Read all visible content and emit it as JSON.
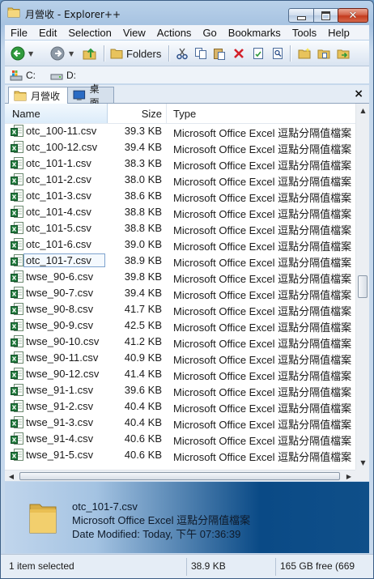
{
  "window": {
    "title": "月營收 - Explorer++",
    "minimize_icon": "minimize-icon",
    "maximize_icon": "maximize-icon",
    "close_icon": "close-icon"
  },
  "menu": {
    "items": [
      "File",
      "Edit",
      "Selection",
      "View",
      "Actions",
      "Go",
      "Bookmarks",
      "Tools",
      "Help"
    ]
  },
  "toolbar": {
    "folders_label": "Folders",
    "icons": [
      "back-icon",
      "forward-icon",
      "up-icon",
      "folders-icon",
      "cut-icon",
      "copy-icon",
      "paste-icon",
      "delete-icon",
      "properties-icon",
      "search-icon",
      "new-folder-icon",
      "copy-to-icon",
      "move-to-icon"
    ]
  },
  "drives": [
    {
      "label": "C:",
      "icon": "system-drive-icon"
    },
    {
      "label": "D:",
      "icon": "drive-icon"
    }
  ],
  "tabs": [
    {
      "label": "月營收",
      "active": true,
      "icon": "folder-icon"
    },
    {
      "label": "桌面",
      "active": false,
      "icon": "desktop-icon"
    }
  ],
  "tab_close_label": "×",
  "columns": {
    "name": "Name",
    "size": "Size",
    "type": "Type"
  },
  "files": [
    {
      "name": "otc_100-11.csv",
      "size": "39.3 KB",
      "type": "Microsoft Office Excel 逗點分隔值檔案"
    },
    {
      "name": "otc_100-12.csv",
      "size": "39.4 KB",
      "type": "Microsoft Office Excel 逗點分隔值檔案"
    },
    {
      "name": "otc_101-1.csv",
      "size": "38.3 KB",
      "type": "Microsoft Office Excel 逗點分隔值檔案"
    },
    {
      "name": "otc_101-2.csv",
      "size": "38.0 KB",
      "type": "Microsoft Office Excel 逗點分隔值檔案"
    },
    {
      "name": "otc_101-3.csv",
      "size": "38.6 KB",
      "type": "Microsoft Office Excel 逗點分隔值檔案"
    },
    {
      "name": "otc_101-4.csv",
      "size": "38.8 KB",
      "type": "Microsoft Office Excel 逗點分隔值檔案"
    },
    {
      "name": "otc_101-5.csv",
      "size": "38.8 KB",
      "type": "Microsoft Office Excel 逗點分隔值檔案"
    },
    {
      "name": "otc_101-6.csv",
      "size": "39.0 KB",
      "type": "Microsoft Office Excel 逗點分隔值檔案"
    },
    {
      "name": "otc_101-7.csv",
      "size": "38.9 KB",
      "type": "Microsoft Office Excel 逗點分隔值檔案",
      "selected": true
    },
    {
      "name": "twse_90-6.csv",
      "size": "39.8 KB",
      "type": "Microsoft Office Excel 逗點分隔值檔案"
    },
    {
      "name": "twse_90-7.csv",
      "size": "39.4 KB",
      "type": "Microsoft Office Excel 逗點分隔值檔案"
    },
    {
      "name": "twse_90-8.csv",
      "size": "41.7 KB",
      "type": "Microsoft Office Excel 逗點分隔值檔案"
    },
    {
      "name": "twse_90-9.csv",
      "size": "42.5 KB",
      "type": "Microsoft Office Excel 逗點分隔值檔案"
    },
    {
      "name": "twse_90-10.csv",
      "size": "41.2 KB",
      "type": "Microsoft Office Excel 逗點分隔值檔案"
    },
    {
      "name": "twse_90-11.csv",
      "size": "40.9 KB",
      "type": "Microsoft Office Excel 逗點分隔值檔案"
    },
    {
      "name": "twse_90-12.csv",
      "size": "41.4 KB",
      "type": "Microsoft Office Excel 逗點分隔值檔案"
    },
    {
      "name": "twse_91-1.csv",
      "size": "39.6 KB",
      "type": "Microsoft Office Excel 逗點分隔值檔案"
    },
    {
      "name": "twse_91-2.csv",
      "size": "40.4 KB",
      "type": "Microsoft Office Excel 逗點分隔值檔案"
    },
    {
      "name": "twse_91-3.csv",
      "size": "40.4 KB",
      "type": "Microsoft Office Excel 逗點分隔值檔案"
    },
    {
      "name": "twse_91-4.csv",
      "size": "40.6 KB",
      "type": "Microsoft Office Excel 逗點分隔值檔案"
    },
    {
      "name": "twse_91-5.csv",
      "size": "40.6 KB",
      "type": "Microsoft Office Excel 逗點分隔值檔案"
    }
  ],
  "display": {
    "file_name": "otc_101-7.csv",
    "file_type": "Microsoft Office Excel 逗點分隔值檔案",
    "date_modified": "Date Modified: Today, 下午 07:36:39",
    "icon": "folder-icon"
  },
  "status": {
    "selection": "1 item selected",
    "size": "38.9 KB",
    "free": "165 GB free (669"
  },
  "colors": {
    "accent_blue": "#3d5f86",
    "close_red": "#c43b1d",
    "selection_border": "#7da2ce",
    "excel_green": "#1f7a3a"
  }
}
